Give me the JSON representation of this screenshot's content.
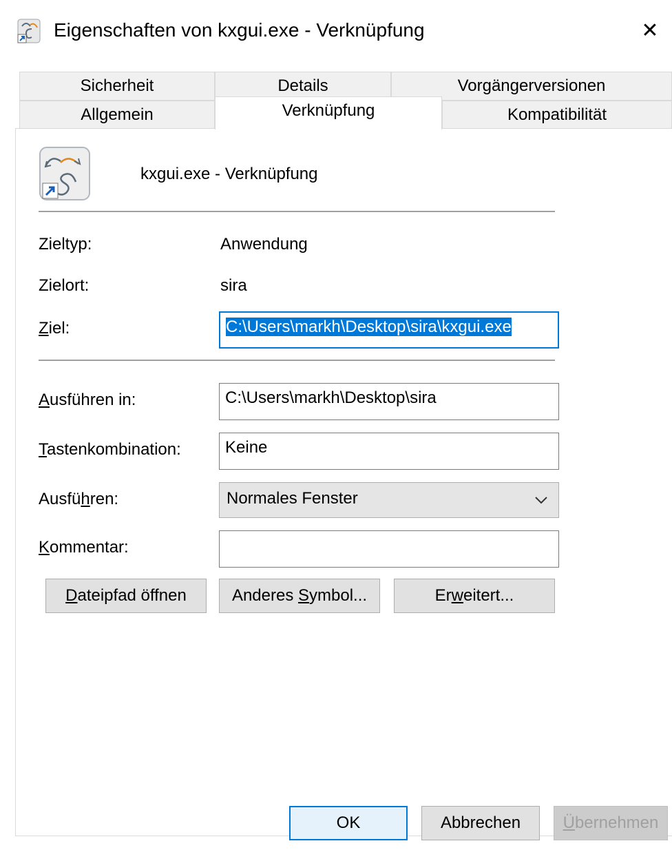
{
  "window": {
    "title": "Eigenschaften von kxgui.exe - Verknüpfung",
    "close_glyph": "✕"
  },
  "tabs_row1": [
    "Sicherheit",
    "Details",
    "Vorgängerversionen"
  ],
  "tabs_row2": [
    "Allgemein",
    "Verknüpfung",
    "Kompatibilität"
  ],
  "active_tab": "Verknüpfung",
  "header": {
    "name": "kxgui.exe - Verknüpfung",
    "icon": "shortcut-app-icon"
  },
  "info": {
    "zieltyp_label": "Zieltyp:",
    "zieltyp_value": "Anwendung",
    "zielort_label": "Zielort:",
    "zielort_value": "sira"
  },
  "ziel": {
    "label_mnemonic": "Z",
    "label_rest": "iel:",
    "value": "C:\\Users\\markh\\Desktop\\sira\\kxgui.exe"
  },
  "ausfuehren_in": {
    "label_mnemonic": "A",
    "label_rest": "usführen in:",
    "value": "C:\\Users\\markh\\Desktop\\sira"
  },
  "tastenkombination": {
    "label_mnemonic": "T",
    "label_rest": "astenkombination:",
    "value": "Keine"
  },
  "ausfuehren": {
    "label_pre": "Ausfü",
    "label_mnemonic": "h",
    "label_post": "ren:",
    "value": "Normales Fenster"
  },
  "kommentar": {
    "label_mnemonic": "K",
    "label_rest": "ommentar:",
    "value": ""
  },
  "action_buttons": {
    "open_path_mnemonic": "D",
    "open_path_rest": "ateipfad öffnen",
    "change_icon_pre": "Anderes ",
    "change_icon_mnemonic": "S",
    "change_icon_post": "ymbol...",
    "advanced_pre": "Er",
    "advanced_mnemonic": "w",
    "advanced_post": "eitert..."
  },
  "dialog_buttons": {
    "ok": "OK",
    "cancel": "Abbrechen",
    "apply_mnemonic": "Ü",
    "apply_rest": "bernehmen"
  },
  "colors": {
    "accent": "#0078d7",
    "selection_text": "#ffffff",
    "disabled_text": "#a0a0a0"
  }
}
